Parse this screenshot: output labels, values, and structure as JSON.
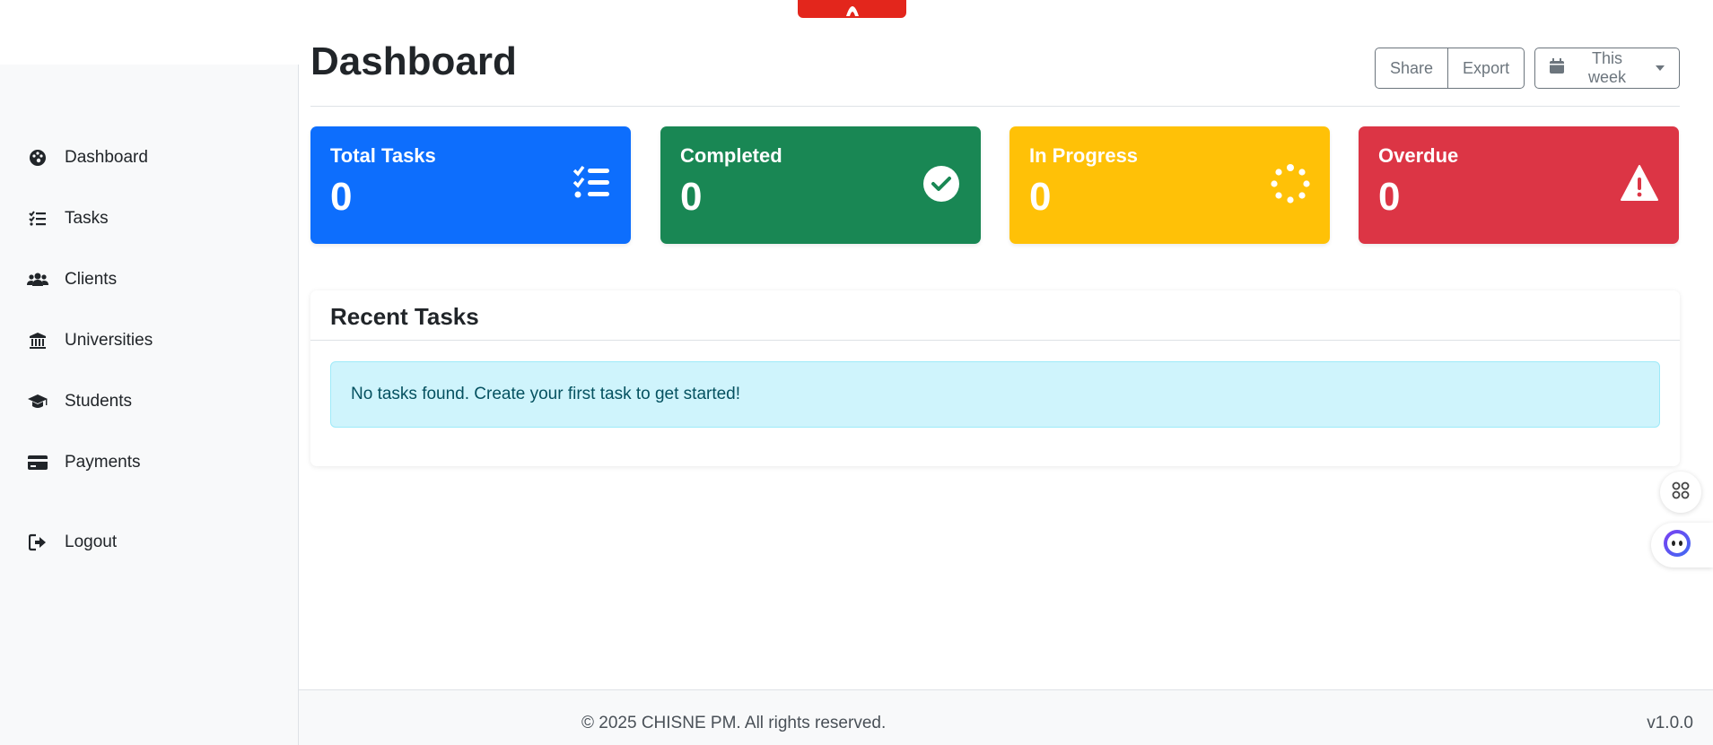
{
  "sidebar": {
    "items": [
      {
        "label": "Dashboard",
        "icon": "palette-icon"
      },
      {
        "label": "Tasks",
        "icon": "list-check-icon"
      },
      {
        "label": "Clients",
        "icon": "users-icon"
      },
      {
        "label": "Universities",
        "icon": "bank-icon"
      },
      {
        "label": "Students",
        "icon": "graduation-cap-icon"
      },
      {
        "label": "Payments",
        "icon": "credit-card-icon"
      }
    ],
    "logout": {
      "label": "Logout",
      "icon": "logout-icon"
    }
  },
  "header": {
    "title": "Dashboard",
    "share_label": "Share",
    "export_label": "Export",
    "range_label": "This week"
  },
  "cards": [
    {
      "label": "Total Tasks",
      "value": "0",
      "color": "#0d6efd",
      "icon": "tasks-list-icon"
    },
    {
      "label": "Completed",
      "value": "0",
      "color": "#198754",
      "icon": "check-circle-icon"
    },
    {
      "label": "In Progress",
      "value": "0",
      "color": "#ffc107",
      "icon": "spinner-icon"
    },
    {
      "label": "Overdue",
      "value": "0",
      "color": "#dc3545",
      "icon": "warning-icon"
    }
  ],
  "recent": {
    "title": "Recent Tasks",
    "empty_message": "No tasks found. Create your first task to get started!"
  },
  "footer": {
    "copyright": "© 2025 CHISNE PM. All rights reserved.",
    "version": "v1.0.0"
  }
}
